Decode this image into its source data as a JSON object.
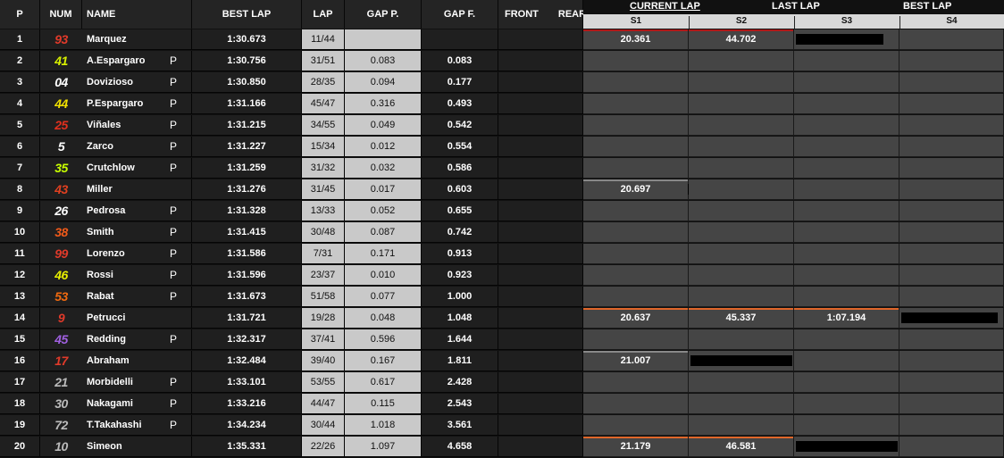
{
  "headers": {
    "p": "P",
    "num": "NUM",
    "name": "NAME",
    "best_lap": "BEST LAP",
    "lap": "LAP",
    "gap_p": "GAP P.",
    "gap_f": "GAP F.",
    "front": "FRONT",
    "rear": "REAR",
    "current_lap": "CURRENT LAP",
    "last_lap": "LAST LAP",
    "best_lap_right": "BEST LAP",
    "s1": "S1",
    "s2": "S2",
    "s3": "S3",
    "s4": "S4"
  },
  "rows": [
    {
      "pos": "1",
      "num": "93",
      "num_color": "#e23a2a",
      "name": "Marquez",
      "pit": "",
      "best": "1:30.673",
      "lap": "11/44",
      "gap_p": "",
      "gap_f": "",
      "s1": "20.361",
      "s2": "44.702",
      "s3": "",
      "s4": ""
    },
    {
      "pos": "2",
      "num": "41",
      "num_color": "#d8f000",
      "name": "A.Espargaro",
      "pit": "P",
      "best": "1:30.756",
      "lap": "31/51",
      "gap_p": "0.083",
      "gap_f": "0.083",
      "s1": "",
      "s2": "",
      "s3": "",
      "s4": ""
    },
    {
      "pos": "3",
      "num": "04",
      "num_color": "#ffffff",
      "name": "Dovizioso",
      "pit": "P",
      "best": "1:30.850",
      "lap": "28/35",
      "gap_p": "0.094",
      "gap_f": "0.177",
      "s1": "",
      "s2": "",
      "s3": "",
      "s4": ""
    },
    {
      "pos": "4",
      "num": "44",
      "num_color": "#f0e000",
      "name": "P.Espargaro",
      "pit": "P",
      "best": "1:31.166",
      "lap": "45/47",
      "gap_p": "0.316",
      "gap_f": "0.493",
      "s1": "",
      "s2": "",
      "s3": "",
      "s4": ""
    },
    {
      "pos": "5",
      "num": "25",
      "num_color": "#e0301e",
      "name": "Viñales",
      "pit": "P",
      "best": "1:31.215",
      "lap": "34/55",
      "gap_p": "0.049",
      "gap_f": "0.542",
      "s1": "",
      "s2": "",
      "s3": "",
      "s4": ""
    },
    {
      "pos": "6",
      "num": "5",
      "num_color": "#ffffff",
      "name": "Zarco",
      "pit": "P",
      "best": "1:31.227",
      "lap": "15/34",
      "gap_p": "0.012",
      "gap_f": "0.554",
      "s1": "",
      "s2": "",
      "s3": "",
      "s4": ""
    },
    {
      "pos": "7",
      "num": "35",
      "num_color": "#c8ff00",
      "name": "Crutchlow",
      "pit": "P",
      "best": "1:31.259",
      "lap": "31/32",
      "gap_p": "0.032",
      "gap_f": "0.586",
      "s1": "",
      "s2": "",
      "s3": "",
      "s4": ""
    },
    {
      "pos": "8",
      "num": "43",
      "num_color": "#e04020",
      "name": "Miller",
      "pit": "",
      "best": "1:31.276",
      "lap": "31/45",
      "gap_p": "0.017",
      "gap_f": "0.603",
      "s1": "20.697",
      "s2": "",
      "s3": "",
      "s4": ""
    },
    {
      "pos": "9",
      "num": "26",
      "num_color": "#ffffff",
      "name": "Pedrosa",
      "pit": "P",
      "best": "1:31.328",
      "lap": "13/33",
      "gap_p": "0.052",
      "gap_f": "0.655",
      "s1": "",
      "s2": "",
      "s3": "",
      "s4": ""
    },
    {
      "pos": "10",
      "num": "38",
      "num_color": "#f05a1a",
      "name": "Smith",
      "pit": "P",
      "best": "1:31.415",
      "lap": "30/48",
      "gap_p": "0.087",
      "gap_f": "0.742",
      "s1": "",
      "s2": "",
      "s3": "",
      "s4": ""
    },
    {
      "pos": "11",
      "num": "99",
      "num_color": "#e03a2a",
      "name": "Lorenzo",
      "pit": "P",
      "best": "1:31.586",
      "lap": "7/31",
      "gap_p": "0.171",
      "gap_f": "0.913",
      "s1": "",
      "s2": "",
      "s3": "",
      "s4": ""
    },
    {
      "pos": "12",
      "num": "46",
      "num_color": "#e8f000",
      "name": "Rossi",
      "pit": "P",
      "best": "1:31.596",
      "lap": "23/37",
      "gap_p": "0.010",
      "gap_f": "0.923",
      "s1": "",
      "s2": "",
      "s3": "",
      "s4": ""
    },
    {
      "pos": "13",
      "num": "53",
      "num_color": "#f06a10",
      "name": "Rabat",
      "pit": "P",
      "best": "1:31.673",
      "lap": "51/58",
      "gap_p": "0.077",
      "gap_f": "1.000",
      "s1": "",
      "s2": "",
      "s3": "",
      "s4": ""
    },
    {
      "pos": "14",
      "num": "9",
      "num_color": "#e03a2a",
      "name": "Petrucci",
      "pit": "",
      "best": "1:31.721",
      "lap": "19/28",
      "gap_p": "0.048",
      "gap_f": "1.048",
      "s1": "20.637",
      "s2": "45.337",
      "s3": "1:07.194",
      "s4": ""
    },
    {
      "pos": "15",
      "num": "45",
      "num_color": "#a060e0",
      "name": "Redding",
      "pit": "P",
      "best": "1:32.317",
      "lap": "37/41",
      "gap_p": "0.596",
      "gap_f": "1.644",
      "s1": "",
      "s2": "",
      "s3": "",
      "s4": ""
    },
    {
      "pos": "16",
      "num": "17",
      "num_color": "#e03a2a",
      "name": "Abraham",
      "pit": "",
      "best": "1:32.484",
      "lap": "39/40",
      "gap_p": "0.167",
      "gap_f": "1.811",
      "s1": "21.007",
      "s2": "",
      "s3": "",
      "s4": ""
    },
    {
      "pos": "17",
      "num": "21",
      "num_color": "#bbbbbb",
      "name": "Morbidelli",
      "pit": "P",
      "best": "1:33.101",
      "lap": "53/55",
      "gap_p": "0.617",
      "gap_f": "2.428",
      "s1": "",
      "s2": "",
      "s3": "",
      "s4": ""
    },
    {
      "pos": "18",
      "num": "30",
      "num_color": "#bbbbbb",
      "name": "Nakagami",
      "pit": "P",
      "best": "1:33.216",
      "lap": "44/47",
      "gap_p": "0.115",
      "gap_f": "2.543",
      "s1": "",
      "s2": "",
      "s3": "",
      "s4": ""
    },
    {
      "pos": "19",
      "num": "72",
      "num_color": "#bbbbbb",
      "name": "T.Takahashi",
      "pit": "P",
      "best": "1:34.234",
      "lap": "30/44",
      "gap_p": "1.018",
      "gap_f": "3.561",
      "s1": "",
      "s2": "",
      "s3": "",
      "s4": ""
    },
    {
      "pos": "20",
      "num": "10",
      "num_color": "#bbbbbb",
      "name": "Simeon",
      "pit": "",
      "best": "1:35.331",
      "lap": "22/26",
      "gap_p": "1.097",
      "gap_f": "4.658",
      "s1": "21.179",
      "s2": "46.581",
      "s3": "",
      "s4": ""
    }
  ]
}
